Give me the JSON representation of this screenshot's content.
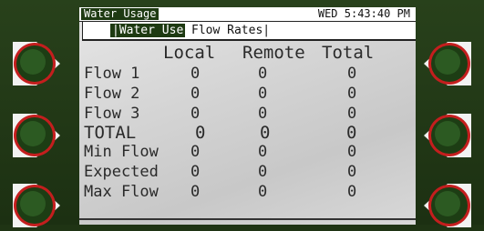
{
  "header": {
    "app_title": "Water Usage",
    "clock": "WED 5:43:40 PM"
  },
  "tabs": [
    {
      "label": "|Water Use"
    },
    {
      "label": "Flow Rates|"
    }
  ],
  "columns": [
    "Local",
    "Remote",
    "Total"
  ],
  "rows": [
    {
      "label": "Flow 1",
      "values": [
        "0",
        "0",
        "0"
      ]
    },
    {
      "label": "Flow 2",
      "values": [
        "0",
        "0",
        "0"
      ]
    },
    {
      "label": "Flow 3",
      "values": [
        "0",
        "0",
        "0"
      ]
    },
    {
      "label": "TOTAL",
      "values": [
        "0",
        "0",
        "0"
      ]
    },
    {
      "label": "Min Flow",
      "values": [
        "0",
        "0",
        "0"
      ]
    },
    {
      "label": "Expected",
      "values": [
        "0",
        "0",
        "0"
      ]
    },
    {
      "label": "Max Flow",
      "values": [
        "0",
        "0",
        "0"
      ]
    }
  ],
  "softkeys": {
    "left": [
      "",
      "",
      ""
    ],
    "right": [
      "",
      "",
      ""
    ]
  }
}
